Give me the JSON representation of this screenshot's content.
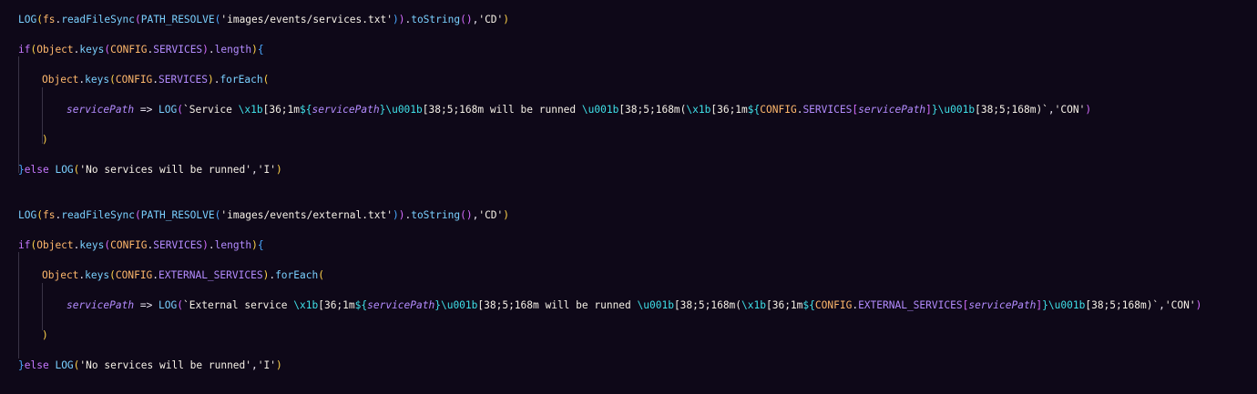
{
  "theme": {
    "background": "#0e0818",
    "default": "#e8e4f0",
    "keyword": "#c678ff",
    "function": "#7ad0ff",
    "builtin": "#ffb86c",
    "string": "#f5f0e6",
    "param": "#b48cff",
    "escape": "#3fe0e8",
    "paren1": "#ffd24a",
    "paren2": "#d56cff",
    "paren3": "#4aa8ff",
    "guide": "#3a3446"
  },
  "code": {
    "lines": [
      {
        "indent": 0,
        "tokens": [
          {
            "text": "LOG",
            "kind": "function"
          },
          {
            "text": "(",
            "kind": "paren1"
          },
          {
            "text": "fs",
            "kind": "builtin"
          },
          {
            "text": ".",
            "kind": "default"
          },
          {
            "text": "readFileSync",
            "kind": "function"
          },
          {
            "text": "(",
            "kind": "paren2"
          },
          {
            "text": "PATH_RESOLVE",
            "kind": "function"
          },
          {
            "text": "(",
            "kind": "paren3"
          },
          {
            "text": "'images/events/services.txt'",
            "kind": "string"
          },
          {
            "text": ")",
            "kind": "paren3"
          },
          {
            "text": ")",
            "kind": "paren2"
          },
          {
            "text": ".",
            "kind": "default"
          },
          {
            "text": "toString",
            "kind": "function"
          },
          {
            "text": "()",
            "kind": "paren2"
          },
          {
            "text": ",",
            "kind": "default"
          },
          {
            "text": "'CD'",
            "kind": "string"
          },
          {
            "text": ")",
            "kind": "paren1"
          }
        ]
      },
      {
        "indent": 0,
        "tokens": [
          {
            "text": "if",
            "kind": "keyword"
          },
          {
            "text": "(",
            "kind": "paren1"
          },
          {
            "text": "Object",
            "kind": "builtin"
          },
          {
            "text": ".",
            "kind": "default"
          },
          {
            "text": "keys",
            "kind": "function"
          },
          {
            "text": "(",
            "kind": "paren2"
          },
          {
            "text": "CONFIG",
            "kind": "builtin"
          },
          {
            "text": ".",
            "kind": "default"
          },
          {
            "text": "SERVICES",
            "kind": "param"
          },
          {
            "text": ")",
            "kind": "paren2"
          },
          {
            "text": ".",
            "kind": "default"
          },
          {
            "text": "length",
            "kind": "param"
          },
          {
            "text": ")",
            "kind": "paren1"
          },
          {
            "text": "{",
            "kind": "paren3"
          }
        ]
      },
      {
        "indent": 1,
        "tokens": [
          {
            "text": "Object",
            "kind": "builtin"
          },
          {
            "text": ".",
            "kind": "default"
          },
          {
            "text": "keys",
            "kind": "function"
          },
          {
            "text": "(",
            "kind": "paren1"
          },
          {
            "text": "CONFIG",
            "kind": "builtin"
          },
          {
            "text": ".",
            "kind": "default"
          },
          {
            "text": "SERVICES",
            "kind": "param"
          },
          {
            "text": ")",
            "kind": "paren1"
          },
          {
            "text": ".",
            "kind": "default"
          },
          {
            "text": "forEach",
            "kind": "function"
          },
          {
            "text": "(",
            "kind": "paren1"
          }
        ]
      },
      {
        "indent": 2,
        "tokens": [
          {
            "text": "servicePath",
            "kind": "param",
            "italic": true
          },
          {
            "text": " => ",
            "kind": "default"
          },
          {
            "text": "LOG",
            "kind": "function"
          },
          {
            "text": "(",
            "kind": "paren2"
          },
          {
            "text": "`Service ",
            "kind": "string"
          },
          {
            "text": "\\x1b",
            "kind": "escape"
          },
          {
            "text": "[36;1m",
            "kind": "string"
          },
          {
            "text": "${",
            "kind": "escape"
          },
          {
            "text": "servicePath",
            "kind": "param",
            "italic": true
          },
          {
            "text": "}",
            "kind": "escape"
          },
          {
            "text": "\\u001b",
            "kind": "escape"
          },
          {
            "text": "[38;5;168m will be runned ",
            "kind": "string"
          },
          {
            "text": "\\u001b",
            "kind": "escape"
          },
          {
            "text": "[38;5;168m(",
            "kind": "string"
          },
          {
            "text": "\\x1b",
            "kind": "escape"
          },
          {
            "text": "[36;1m",
            "kind": "string"
          },
          {
            "text": "${",
            "kind": "escape"
          },
          {
            "text": "CONFIG",
            "kind": "builtin"
          },
          {
            "text": ".",
            "kind": "default"
          },
          {
            "text": "SERVICES",
            "kind": "param"
          },
          {
            "text": "[",
            "kind": "paren2"
          },
          {
            "text": "servicePath",
            "kind": "param",
            "italic": true
          },
          {
            "text": "]",
            "kind": "paren2"
          },
          {
            "text": "}",
            "kind": "escape"
          },
          {
            "text": "\\u001b",
            "kind": "escape"
          },
          {
            "text": "[38;5;168m)`",
            "kind": "string"
          },
          {
            "text": ",",
            "kind": "default"
          },
          {
            "text": "'CON'",
            "kind": "string"
          },
          {
            "text": ")",
            "kind": "paren2"
          }
        ]
      },
      {
        "indent": 1,
        "tokens": [
          {
            "text": ")",
            "kind": "paren1"
          }
        ]
      },
      {
        "indent": 0,
        "tokens": [
          {
            "text": "}",
            "kind": "paren3"
          },
          {
            "text": "else",
            "kind": "keyword"
          },
          {
            "text": " ",
            "kind": "default"
          },
          {
            "text": "LOG",
            "kind": "function"
          },
          {
            "text": "(",
            "kind": "paren1"
          },
          {
            "text": "'No services will be runned'",
            "kind": "string"
          },
          {
            "text": ",",
            "kind": "default"
          },
          {
            "text": "'I'",
            "kind": "string"
          },
          {
            "text": ")",
            "kind": "paren1"
          }
        ]
      },
      {
        "indent": 0,
        "tokens": [
          {
            "text": "LOG",
            "kind": "function"
          },
          {
            "text": "(",
            "kind": "paren1"
          },
          {
            "text": "fs",
            "kind": "builtin"
          },
          {
            "text": ".",
            "kind": "default"
          },
          {
            "text": "readFileSync",
            "kind": "function"
          },
          {
            "text": "(",
            "kind": "paren2"
          },
          {
            "text": "PATH_RESOLVE",
            "kind": "function"
          },
          {
            "text": "(",
            "kind": "paren3"
          },
          {
            "text": "'images/events/external.txt'",
            "kind": "string"
          },
          {
            "text": ")",
            "kind": "paren3"
          },
          {
            "text": ")",
            "kind": "paren2"
          },
          {
            "text": ".",
            "kind": "default"
          },
          {
            "text": "toString",
            "kind": "function"
          },
          {
            "text": "()",
            "kind": "paren2"
          },
          {
            "text": ",",
            "kind": "default"
          },
          {
            "text": "'CD'",
            "kind": "string"
          },
          {
            "text": ")",
            "kind": "paren1"
          }
        ]
      },
      {
        "indent": 0,
        "tokens": [
          {
            "text": "if",
            "kind": "keyword"
          },
          {
            "text": "(",
            "kind": "paren1"
          },
          {
            "text": "Object",
            "kind": "builtin"
          },
          {
            "text": ".",
            "kind": "default"
          },
          {
            "text": "keys",
            "kind": "function"
          },
          {
            "text": "(",
            "kind": "paren2"
          },
          {
            "text": "CONFIG",
            "kind": "builtin"
          },
          {
            "text": ".",
            "kind": "default"
          },
          {
            "text": "SERVICES",
            "kind": "param"
          },
          {
            "text": ")",
            "kind": "paren2"
          },
          {
            "text": ".",
            "kind": "default"
          },
          {
            "text": "length",
            "kind": "param"
          },
          {
            "text": ")",
            "kind": "paren1"
          },
          {
            "text": "{",
            "kind": "paren3"
          }
        ]
      },
      {
        "indent": 1,
        "tokens": [
          {
            "text": "Object",
            "kind": "builtin"
          },
          {
            "text": ".",
            "kind": "default"
          },
          {
            "text": "keys",
            "kind": "function"
          },
          {
            "text": "(",
            "kind": "paren1"
          },
          {
            "text": "CONFIG",
            "kind": "builtin"
          },
          {
            "text": ".",
            "kind": "default"
          },
          {
            "text": "EXTERNAL_SERVICES",
            "kind": "param"
          },
          {
            "text": ")",
            "kind": "paren1"
          },
          {
            "text": ".",
            "kind": "default"
          },
          {
            "text": "forEach",
            "kind": "function"
          },
          {
            "text": "(",
            "kind": "paren1"
          }
        ]
      },
      {
        "indent": 2,
        "tokens": [
          {
            "text": "servicePath",
            "kind": "param",
            "italic": true
          },
          {
            "text": " => ",
            "kind": "default"
          },
          {
            "text": "LOG",
            "kind": "function"
          },
          {
            "text": "(",
            "kind": "paren2"
          },
          {
            "text": "`External service ",
            "kind": "string"
          },
          {
            "text": "\\x1b",
            "kind": "escape"
          },
          {
            "text": "[36;1m",
            "kind": "string"
          },
          {
            "text": "${",
            "kind": "escape"
          },
          {
            "text": "servicePath",
            "kind": "param",
            "italic": true
          },
          {
            "text": "}",
            "kind": "escape"
          },
          {
            "text": "\\u001b",
            "kind": "escape"
          },
          {
            "text": "[38;5;168m will be runned ",
            "kind": "string"
          },
          {
            "text": "\\u001b",
            "kind": "escape"
          },
          {
            "text": "[38;5;168m(",
            "kind": "string"
          },
          {
            "text": "\\x1b",
            "kind": "escape"
          },
          {
            "text": "[36;1m",
            "kind": "string"
          },
          {
            "text": "${",
            "kind": "escape"
          },
          {
            "text": "CONFIG",
            "kind": "builtin"
          },
          {
            "text": ".",
            "kind": "default"
          },
          {
            "text": "EXTERNAL_SERVICES",
            "kind": "param"
          },
          {
            "text": "[",
            "kind": "paren2"
          },
          {
            "text": "servicePath",
            "kind": "param",
            "italic": true
          },
          {
            "text": "]",
            "kind": "paren2"
          },
          {
            "text": "}",
            "kind": "escape"
          },
          {
            "text": "\\u001b",
            "kind": "escape"
          },
          {
            "text": "[38;5;168m)`",
            "kind": "string"
          },
          {
            "text": ",",
            "kind": "default"
          },
          {
            "text": "'CON'",
            "kind": "string"
          },
          {
            "text": ")",
            "kind": "paren2"
          }
        ]
      },
      {
        "indent": 1,
        "tokens": [
          {
            "text": ")",
            "kind": "paren1"
          }
        ]
      },
      {
        "indent": 0,
        "tokens": [
          {
            "text": "}",
            "kind": "paren3"
          },
          {
            "text": "else",
            "kind": "keyword"
          },
          {
            "text": " ",
            "kind": "default"
          },
          {
            "text": "LOG",
            "kind": "function"
          },
          {
            "text": "(",
            "kind": "paren1"
          },
          {
            "text": "'No services will be runned'",
            "kind": "string"
          },
          {
            "text": ",",
            "kind": "default"
          },
          {
            "text": "'I'",
            "kind": "string"
          },
          {
            "text": ")",
            "kind": "paren1"
          }
        ]
      }
    ]
  }
}
